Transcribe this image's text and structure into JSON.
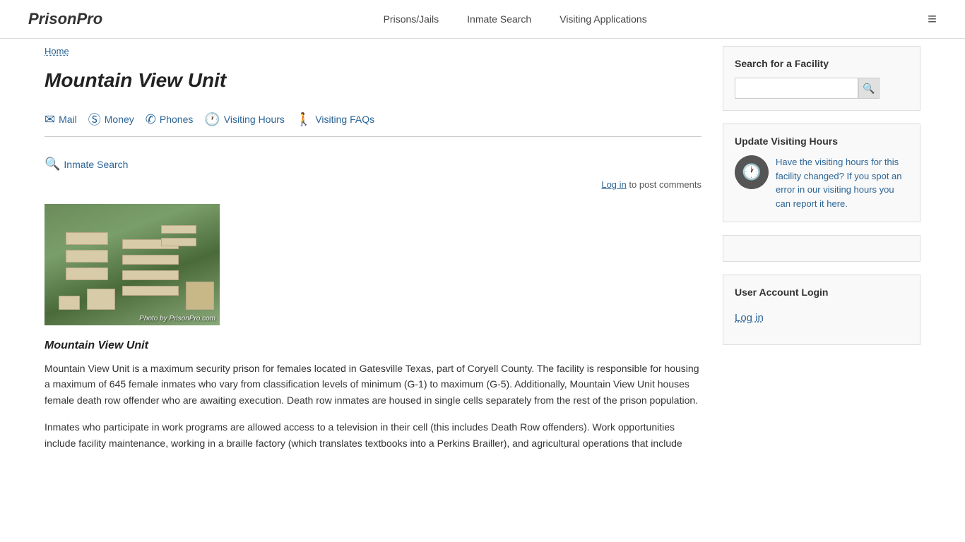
{
  "site": {
    "logo": "PrisonPro",
    "nav": {
      "item1": "Prisons/Jails",
      "item2": "Inmate Search",
      "item3": "Visiting Applications"
    }
  },
  "breadcrumb": {
    "home_label": "Home",
    "home_href": "#"
  },
  "facility": {
    "title": "Mountain View Unit",
    "subtitle": "Mountain View Unit",
    "tabs": [
      {
        "id": "mail",
        "label": "Mail",
        "icon": "✉"
      },
      {
        "id": "money",
        "label": "Money",
        "icon": "Ⓢ"
      },
      {
        "id": "phones",
        "label": "Phones",
        "icon": "✆"
      },
      {
        "id": "visiting-hours",
        "label": "Visiting Hours",
        "icon": "🕐"
      },
      {
        "id": "visiting-faqs",
        "label": "Visiting FAQs",
        "icon": "🚶"
      }
    ],
    "inmate_search_label": "Inmate Search",
    "photo_credit": "Photo by PrisonPro.com",
    "description1": "Mountain View Unit is a maximum security prison for females located in Gatesville Texas, part of Coryell County.  The facility is responsible for housing a maximum of 645 female inmates who vary from classification levels of minimum (G-1) to maximum (G-5).  Additionally, Mountain View Unit houses female death row offender who are awaiting execution.  Death row inmates are housed in single cells separately from the rest of the prison population.",
    "description2": "Inmates who participate in work programs are allowed access to a television in their cell (this includes Death Row offenders).  Work opportunities include facility maintenance, working in a braille factory (which translates textbooks into a Perkins Brailler), and agricultural operations that include",
    "login_prompt": "to post comments",
    "login_link_label": "Log in"
  },
  "sidebar": {
    "search": {
      "title": "Search for a Facility",
      "placeholder": "",
      "btn_label": "🔍"
    },
    "update_visiting": {
      "title": "Update Visiting Hours",
      "link_text": "Have the visiting hours for this facility changed?  If you spot an error in our visiting hours you can report it here."
    },
    "user_account": {
      "title": "User Account Login",
      "login_label": "Log in"
    }
  }
}
